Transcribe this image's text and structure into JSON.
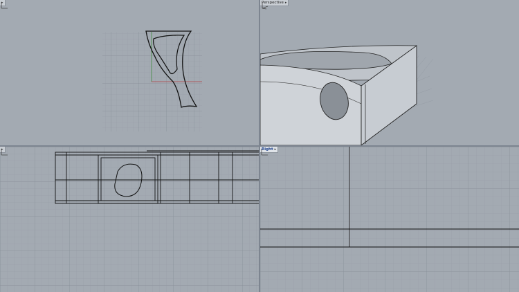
{
  "viewports": {
    "top": {
      "name": "",
      "caret": "▸"
    },
    "perspective": {
      "name": "Perspective",
      "caret": "▸"
    },
    "front": {
      "name": "",
      "caret": "▸"
    },
    "right": {
      "name": "Right",
      "caret": "▸"
    }
  },
  "active_viewport": "right",
  "colors": {
    "viewport_bg": "#a3aab2",
    "grid_minor": "#959ca5",
    "grid_major": "#858c95",
    "x_axis": "#b04040",
    "y_axis": "#3f8a3f",
    "curve": "#111111"
  },
  "icons": [
    "axis-indicator-icon",
    "viewport-menu-caret-icon"
  ]
}
